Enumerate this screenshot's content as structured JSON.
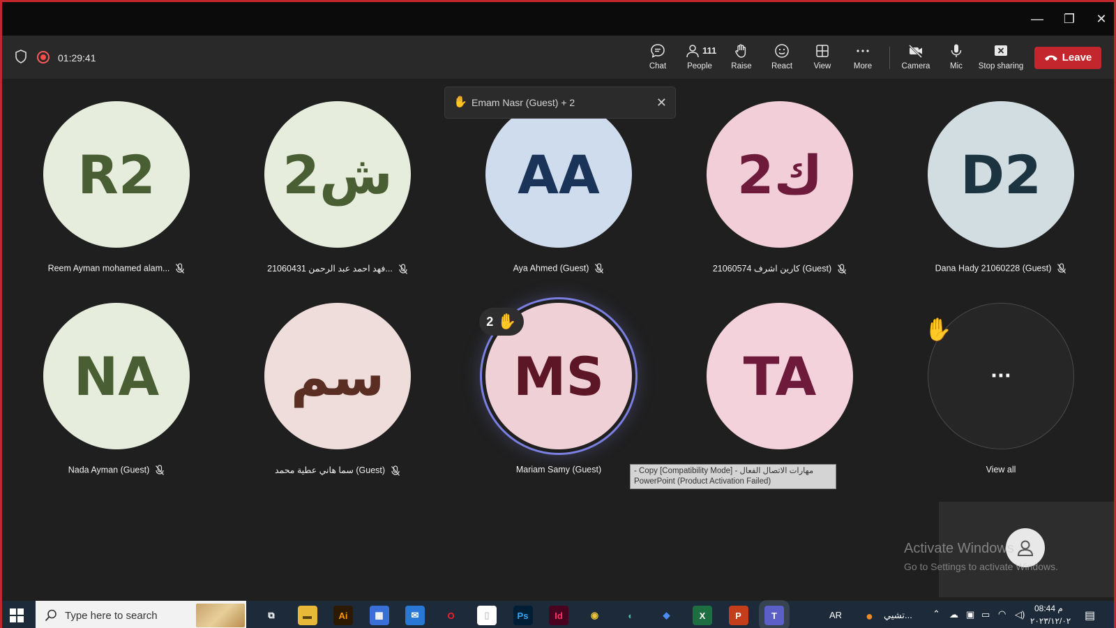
{
  "window": {
    "minimize_glyph": "—",
    "maximize_glyph": "❐",
    "close_glyph": "✕"
  },
  "toolbar": {
    "timer": "01:29:41",
    "chat_label": "Chat",
    "people_label": "People",
    "people_count": "111",
    "raise_label": "Raise",
    "react_label": "React",
    "view_label": "View",
    "more_label": "More",
    "camera_label": "Camera",
    "mic_label": "Mic",
    "stop_sharing_label": "Stop sharing",
    "leave_label": "Leave"
  },
  "notification": {
    "text": "Emam Nasr (Guest) + 2",
    "hand": "✋",
    "close": "✕"
  },
  "participants": [
    {
      "initials": "R2",
      "name": "Reem Ayman mohamed alam...",
      "bg": "#e6eddc",
      "fg": "#4a5e34"
    },
    {
      "initials": "ش2",
      "name": "فهد احمد عبد الرحمن 21060431...",
      "bg": "#e6eddc",
      "fg": "#4a5e34"
    },
    {
      "initials": "AA",
      "name": "Aya Ahmed (Guest)",
      "bg": "#cfdcee",
      "fg": "#1a3358"
    },
    {
      "initials": "ك2",
      "name": "كارين اشرف 21060574 (Guest)",
      "bg": "#f2cfd8",
      "fg": "#6e1a3a"
    },
    {
      "initials": "D2",
      "name": "Dana Hady 21060228 (Guest)",
      "bg": "#d2dde2",
      "fg": "#1c3340"
    },
    {
      "initials": "NA",
      "name": "Nada Ayman (Guest)",
      "bg": "#e6eddc",
      "fg": "#4a5e34"
    },
    {
      "initials": "سم",
      "name": "سما هاني عطية محمد (Guest)",
      "bg": "#eeddda",
      "fg": "#5a2e22"
    },
    {
      "initials": "MS",
      "name": "Mariam Samy (Guest)",
      "bg": "#efd0d6",
      "fg": "#5c1626"
    },
    {
      "initials": "TA",
      "name": "",
      "bg": "#f4d2dc",
      "fg": "#6e1a3a"
    }
  ],
  "view_all": {
    "label": "View all",
    "ellipsis": "···",
    "hand": "✋"
  },
  "raise_badge": {
    "count": "2",
    "hand": "✋"
  },
  "tooltip": {
    "line1": "مهارات الاتصال الفعال - Copy [Compatibility Mode] -",
    "line2": "PowerPoint (Product Activation Failed)"
  },
  "activate_windows": {
    "title": "Activate Windows",
    "subtitle": "Go to Settings to activate Windows."
  },
  "taskbar": {
    "search_placeholder": "Type here to search",
    "apps": [
      {
        "name": "task-view",
        "glyph": "⧉",
        "bg": "transparent",
        "fg": "#ffffff"
      },
      {
        "name": "file-explorer",
        "glyph": "▬",
        "bg": "#e8b838",
        "fg": "#5a4210"
      },
      {
        "name": "illustrator",
        "glyph": "Ai",
        "bg": "#2b1a00",
        "fg": "#ff9a00"
      },
      {
        "name": "store",
        "glyph": "▦",
        "bg": "#3a6fd8",
        "fg": "#ffffff"
      },
      {
        "name": "mail",
        "glyph": "✉",
        "bg": "#2a78d6",
        "fg": "#ffffff"
      },
      {
        "name": "opera",
        "glyph": "O",
        "bg": "transparent",
        "fg": "#ff1b2d"
      },
      {
        "name": "notepad",
        "glyph": "▯",
        "bg": "#ffffff",
        "fg": "#cccccc"
      },
      {
        "name": "photoshop",
        "glyph": "Ps",
        "bg": "#001e36",
        "fg": "#31a8ff"
      },
      {
        "name": "indesign",
        "glyph": "Id",
        "bg": "#49021f",
        "fg": "#ff3366"
      },
      {
        "name": "chrome",
        "glyph": "◉",
        "bg": "transparent",
        "fg": "#e8c33a"
      },
      {
        "name": "edge",
        "glyph": "◐",
        "bg": "transparent",
        "fg": "#3cc2a6"
      },
      {
        "name": "power-automate",
        "glyph": "◆",
        "bg": "transparent",
        "fg": "#4d8bf5"
      },
      {
        "name": "excel",
        "glyph": "X",
        "bg": "#1d6f42",
        "fg": "#ffffff"
      },
      {
        "name": "powerpoint",
        "glyph": "P",
        "bg": "#c43e1c",
        "fg": "#ffffff"
      },
      {
        "name": "teams",
        "glyph": "T",
        "bg": "#5b5fc7",
        "fg": "#ffffff"
      }
    ],
    "language": "AR",
    "weather_text": "تشيي...",
    "time": "08:44 م",
    "date": "٢٠٢٣/١٢/٠٢"
  }
}
